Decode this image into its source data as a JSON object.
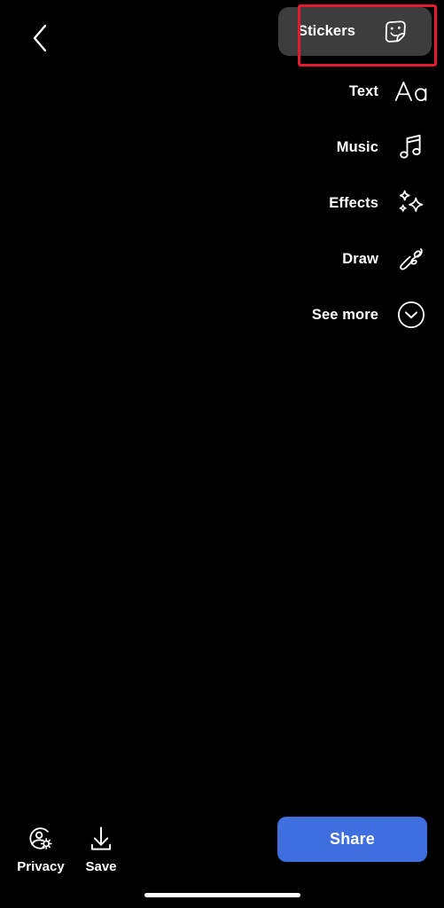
{
  "screen": {
    "name": "story-editor",
    "background_color": "#000000"
  },
  "navigation": {
    "back_icon": "chevron-left-icon"
  },
  "annotation": {
    "highlight_color": "#e8192c",
    "target": "Stickers"
  },
  "tool_menu": {
    "items": [
      {
        "label": "Stickers",
        "icon": "sticker-face-icon",
        "selected": true,
        "background_color": "#3d3d3d"
      },
      {
        "label": "Text",
        "icon": "text-aa-icon",
        "selected": false,
        "background_color": ""
      },
      {
        "label": "Music",
        "icon": "music-note-icon",
        "selected": false,
        "background_color": ""
      },
      {
        "label": "Effects",
        "icon": "sparkles-icon",
        "selected": false,
        "background_color": ""
      },
      {
        "label": "Draw",
        "icon": "scribble-icon",
        "selected": false,
        "background_color": ""
      },
      {
        "label": "See more",
        "icon": "chevron-down-circle-icon",
        "selected": false,
        "background_color": ""
      }
    ]
  },
  "bottom_bar": {
    "actions": [
      {
        "label": "Privacy",
        "icon": "privacy-person-gear-icon"
      },
      {
        "label": "Save",
        "icon": "download-tray-icon"
      }
    ],
    "share_button": {
      "label": "Share",
      "color": "#3f6fdf",
      "text_color": "#ffffff"
    }
  },
  "system": {
    "home_indicator": "home-indicator-bar"
  }
}
